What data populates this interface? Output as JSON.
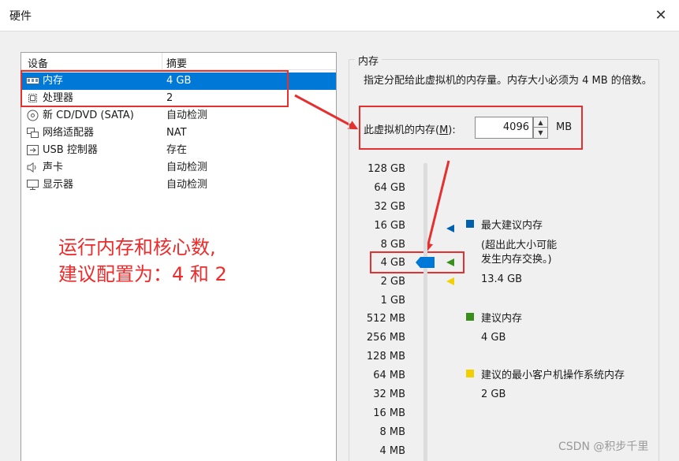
{
  "window": {
    "title": "硬件",
    "close_glyph": "✕"
  },
  "device_table": {
    "columns": [
      "设备",
      "摘要"
    ],
    "rows": [
      {
        "icon": "memory-icon",
        "name": "内存",
        "summary": "4 GB",
        "selected": true
      },
      {
        "icon": "cpu-icon",
        "name": "处理器",
        "summary": "2"
      },
      {
        "icon": "cd-icon",
        "name": "新 CD/DVD (SATA)",
        "summary": "自动检测"
      },
      {
        "icon": "network-icon",
        "name": "网络适配器",
        "summary": "NAT"
      },
      {
        "icon": "usb-icon",
        "name": "USB 控制器",
        "summary": "存在"
      },
      {
        "icon": "sound-icon",
        "name": "声卡",
        "summary": "自动检测"
      },
      {
        "icon": "display-icon",
        "name": "显示器",
        "summary": "自动检测"
      }
    ]
  },
  "annotation": {
    "line1": "运行内存和核心数,",
    "line2": "建议配置为：4 和 2"
  },
  "memory": {
    "group_title": "内存",
    "description": "指定分配给此虚拟机的内存量。内存大小必须为 4 MB 的倍数。",
    "field_label": "此虚拟机的内存(",
    "field_accel": "M",
    "field_label_end": "):",
    "value": "4096",
    "unit": "MB",
    "scale_labels": [
      "128 GB",
      "64 GB",
      "32 GB",
      "16 GB",
      "8 GB",
      "4 GB",
      "2 GB",
      "1 GB",
      "512 MB",
      "256 MB",
      "128 MB",
      "64 MB",
      "32 MB",
      "16 MB",
      "8 MB",
      "4 MB"
    ],
    "selected_label": "4 GB"
  },
  "legend": {
    "max": {
      "title": "最大建议内存",
      "note": "(超出此大小可能\n发生内存交换。)",
      "value": "13.4 GB",
      "color": "#0060b0"
    },
    "recommended": {
      "title": "建议内存",
      "value": "4 GB",
      "color": "#3a8f1c"
    },
    "min": {
      "title": "建议的最小客户机操作系统内存",
      "value": "2 GB",
      "color": "#f2d000"
    }
  },
  "watermark": "CSDN @积步千里",
  "colors": {
    "selection": "#0078d7",
    "annotation": "#e53030"
  }
}
